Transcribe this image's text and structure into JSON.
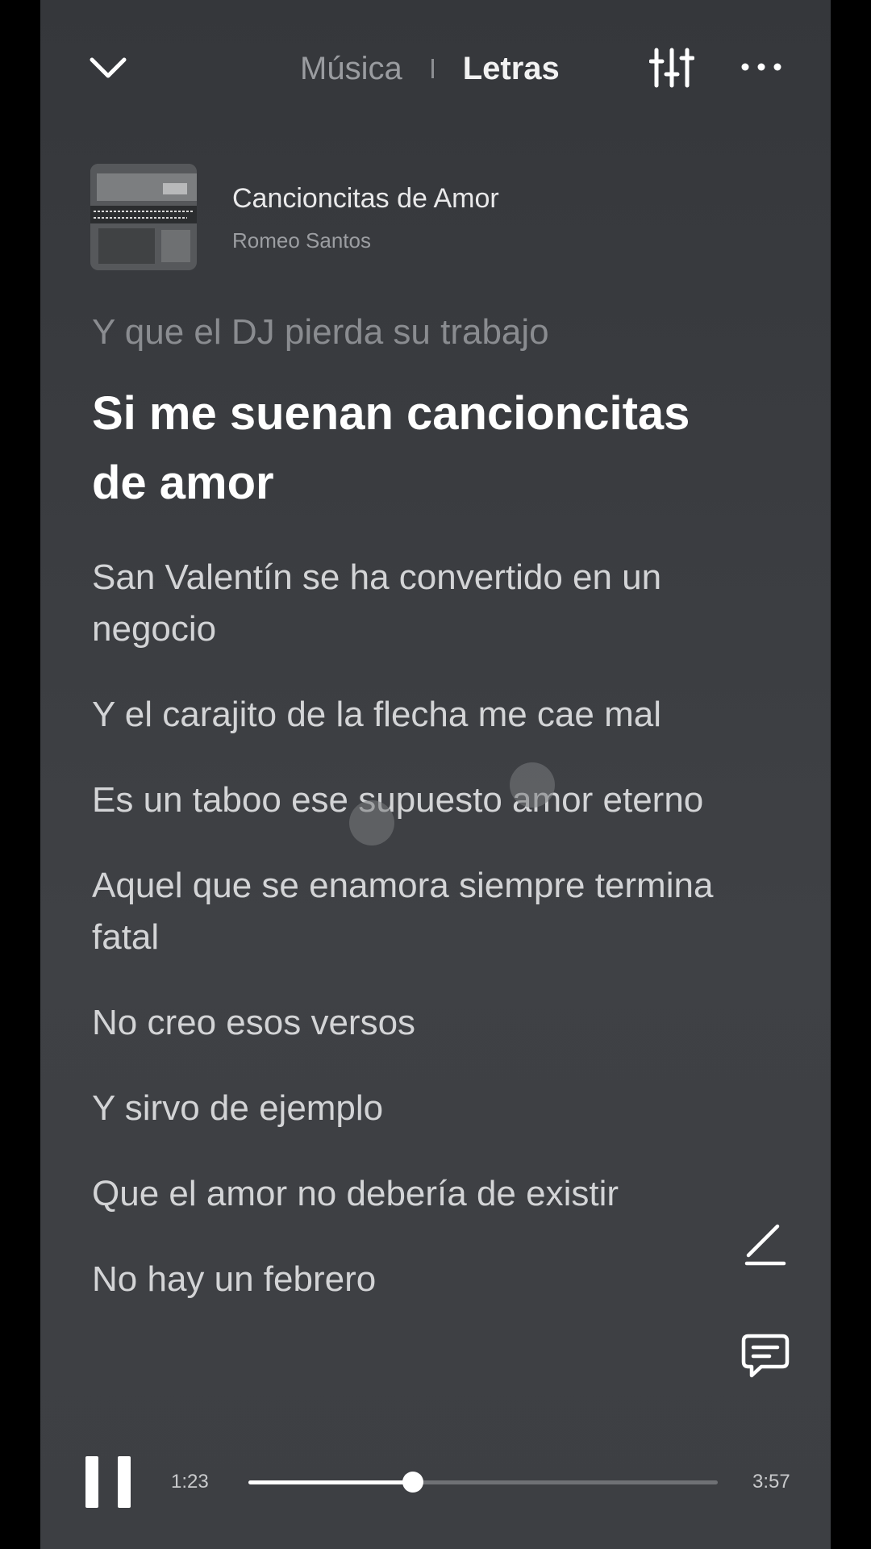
{
  "header": {
    "tab_music": "Música",
    "tab_lyrics": "Letras",
    "active_tab": "Letras"
  },
  "song": {
    "title": "Cancioncitas de Amor",
    "artist": "Romeo Santos"
  },
  "lyrics": [
    {
      "text": "Y que el DJ pierda su trabajo",
      "state": "past"
    },
    {
      "text": "Si me suenan cancioncitas de amor",
      "state": "current"
    },
    {
      "text": "San Valentín se ha convertido en un negocio",
      "state": "upcoming"
    },
    {
      "text": "Y el carajito de la flecha me cae mal",
      "state": "upcoming"
    },
    {
      "text": "Es un taboo ese supuesto amor eterno",
      "state": "upcoming"
    },
    {
      "text": "Aquel que se enamora siempre termina fatal",
      "state": "upcoming"
    },
    {
      "text": "No creo esos versos",
      "state": "upcoming"
    },
    {
      "text": "Y sirvo de ejemplo",
      "state": "upcoming"
    },
    {
      "text": "Que el amor no debería de existir",
      "state": "upcoming"
    },
    {
      "text": "No hay un febrero",
      "state": "upcoming"
    }
  ],
  "player": {
    "current_time": "1:23",
    "total_time": "3:57",
    "progress_fraction": 0.35,
    "is_playing": true
  },
  "icons": {
    "back": "chevron-down-icon",
    "equalizer": "equalizer-icon",
    "more": "more-dots-icon",
    "edit": "pencil-icon",
    "comment": "comment-icon",
    "pause": "pause-icon"
  },
  "colors": {
    "background": "#3b3d41",
    "active_text": "#ffffff",
    "inactive_text": "#d3d4d6",
    "past_text": "#8a8c90"
  }
}
